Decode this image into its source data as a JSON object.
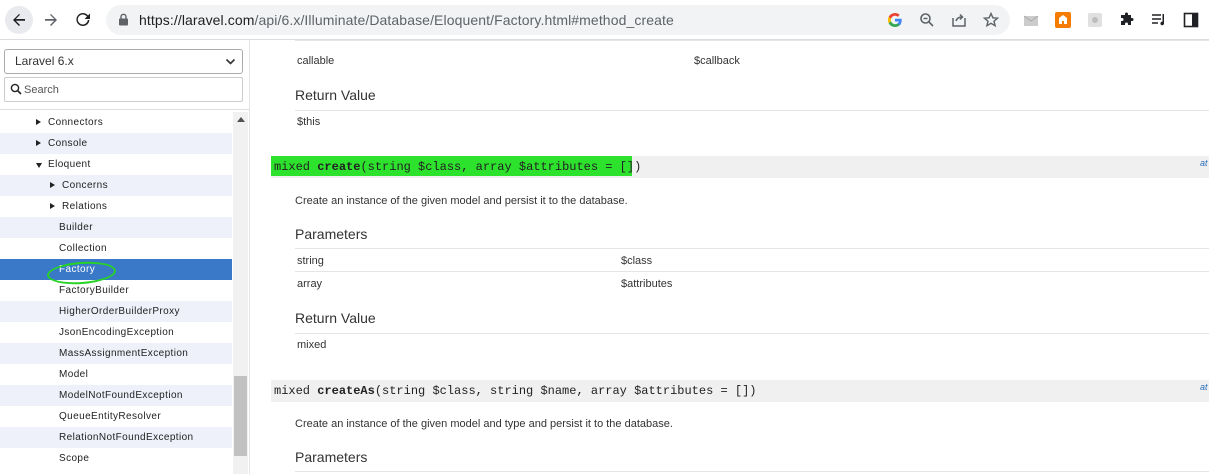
{
  "browser": {
    "url_host": "https://laravel.com",
    "url_path": "/api/6.x/Illuminate/Database/Eloquent/Factory.html#method_create"
  },
  "sidebar": {
    "version": "Laravel 6.x",
    "search_placeholder": "Search",
    "tree": [
      {
        "label": "Connectors",
        "arrow": "right"
      },
      {
        "label": "Console",
        "arrow": "right"
      },
      {
        "label": "Eloquent",
        "arrow": "down"
      },
      {
        "label": "Concerns",
        "arrow": "right"
      },
      {
        "label": "Relations",
        "arrow": "right"
      },
      {
        "label": "Builder"
      },
      {
        "label": "Collection"
      },
      {
        "label": "Factory",
        "selected": true
      },
      {
        "label": "FactoryBuilder"
      },
      {
        "label": "HigherOrderBuilderProxy"
      },
      {
        "label": "JsonEncodingException"
      },
      {
        "label": "MassAssignmentException"
      },
      {
        "label": "Model"
      },
      {
        "label": "ModelNotFoundException"
      },
      {
        "label": "QueueEntityResolver"
      },
      {
        "label": "RelationNotFoundException"
      },
      {
        "label": "Scope"
      }
    ]
  },
  "main": {
    "prev_param": {
      "type": "callable",
      "name": "$callback"
    },
    "prev_return_heading": "Return Value",
    "prev_return_value": "$this",
    "create": {
      "sig_return": "mixed",
      "sig_name": "create",
      "sig_args": "(string $class, array $attributes = [])",
      "at": "at",
      "description": "Create an instance of the given model and persist it to the database.",
      "params_heading": "Parameters",
      "params": [
        {
          "type": "string",
          "name": "$class"
        },
        {
          "type": "array",
          "name": "$attributes"
        }
      ],
      "return_heading": "Return Value",
      "return_value": "mixed"
    },
    "createAs": {
      "sig_return": "mixed",
      "sig_name": "createAs",
      "sig_args": "(string $class, string $name, array $attributes = [])",
      "at": "at",
      "description": "Create an instance of the given model and type and persist it to the database.",
      "params_heading": "Parameters"
    }
  },
  "colors": {
    "selected_row": "#3a78c8",
    "highlight": "#2de22d",
    "annotation_circle": "#27d327"
  }
}
